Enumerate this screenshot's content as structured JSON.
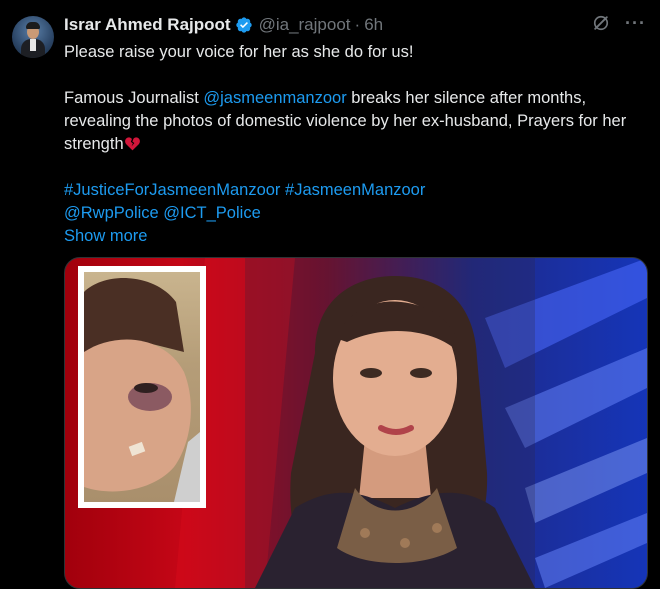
{
  "tweet": {
    "author_name": "Israr Ahmed Rajpoot",
    "handle": "@ia_rajpoot",
    "separator": "·",
    "time": "6h",
    "line1": "Please raise your voice for her as she do for us!",
    "para2_prefix": "Famous Journalist ",
    "mention_journalist": "@jasmeenmanzoor",
    "para2_suffix": " breaks her silence after months, revealing the photos of domestic violence by her ex-husband, Prayers for her strength",
    "hashtag1": "#JusticeForJasmeenManzoor",
    "hashtag2": "#JasmeenManzoor",
    "mention_police1": "@RwpPolice",
    "mention_police2": "@ICT_Police",
    "show_more": "Show more",
    "more_icon": "···"
  },
  "icons": {
    "verified": "verified-badge-icon",
    "grok": "grok-icon",
    "more": "more-icon",
    "broken_heart": "broken-heart-icon"
  },
  "colors": {
    "background": "#000000",
    "text": "#e7e9ea",
    "secondary": "#71767b",
    "link": "#1d9bf0",
    "verified": "#1d9bf0",
    "broken_heart": "#d2163a"
  }
}
